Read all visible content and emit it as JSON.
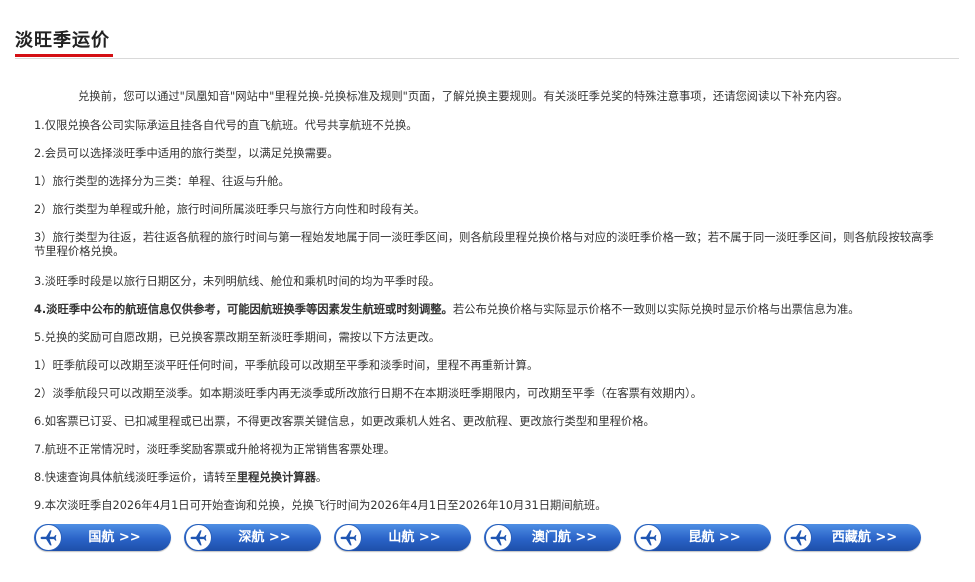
{
  "header": {
    "title": "淡旺季运价"
  },
  "content": {
    "intro": "兑换前，您可以通过\"凤凰知音\"网站中\"里程兑换-兑换标准及规则\"页面，了解兑换主要规则。有关淡旺季兑奖的特殊注意事项，还请您阅读以下补充内容。",
    "item1": "1.仅限兑换各公司实际承运且挂各自代号的直飞航班。代号共享航班不兑换。",
    "item2": "2.会员可以选择淡旺季中适用的旅行类型，以满足兑换需要。",
    "item2_1": "1）旅行类型的选择分为三类：单程、往返与升舱。",
    "item2_2": "2）旅行类型为单程或升舱，旅行时间所属淡旺季只与旅行方向性和时段有关。",
    "item2_3": "3）旅行类型为往返，若往返各航程的旅行时间与第一程始发地属于同一淡旺季区间，则各航段里程兑换价格与对应的淡旺季价格一致；若不属于同一淡旺季区间，则各航段按较高季节里程价格兑换。",
    "item3": "3.淡旺季时段是以旅行日期区分，未列明航线、舱位和乘机时间的均为平季时段。",
    "item4_bold": "4.淡旺季中公布的航班信息仅供参考，可能因航班换季等因素发生航班或时刻调整。",
    "item4_rest": "若公布兑换价格与实际显示价格不一致则以实际兑换时显示价格与出票信息为准。",
    "item5": "5.兑换的奖励可自愿改期，已兑换客票改期至新淡旺季期间，需按以下方法更改。",
    "item5_1": "1）旺季航段可以改期至淡平旺任何时间，平季航段可以改期至平季和淡季时间，里程不再重新计算。",
    "item5_2": "2）淡季航段只可以改期至淡季。如本期淡旺季内再无淡季或所改旅行日期不在本期淡旺季期限内，可改期至平季（在客票有效期内）。",
    "item6": "6.如客票已订妥、已扣减里程或已出票，不得更改客票关键信息，如更改乘机人姓名、更改航程、更改旅行类型和里程价格。",
    "item7": "7.航班不正常情况时，淡旺季奖励客票或升舱将视为正常销售客票处理。",
    "item8_pre": "8.快速查询具体航线淡旺季运价，请转至",
    "item8_link": "里程兑换计算器",
    "item8_post": "。",
    "item9": "9.本次淡旺季自2026年4月1日可开始查询和兑换，兑换飞行时间为2026年4月1日至2026年10月31日期间航班。"
  },
  "buttons": [
    {
      "label": "国航 >>",
      "icon": "airplane-icon"
    },
    {
      "label": "深航 >>",
      "icon": "airplane-icon"
    },
    {
      "label": "山航 >>",
      "icon": "airplane-icon"
    },
    {
      "label": "澳门航 >>",
      "icon": "airplane-icon"
    },
    {
      "label": "昆航 >>",
      "icon": "airplane-icon"
    },
    {
      "label": "西藏航 >>",
      "icon": "airplane-icon"
    }
  ],
  "colors": {
    "accent": "#d40f14",
    "button": "#2a63c7"
  }
}
